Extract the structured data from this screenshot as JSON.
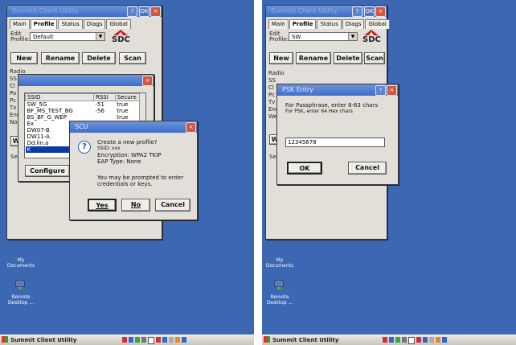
{
  "left": {
    "main_title": "Summit Client Utility",
    "tabs": [
      "Main",
      "Profile",
      "Status",
      "Diags",
      "Global"
    ],
    "edit_profile_label": "Edit\nProfile:",
    "profile_value": "Default",
    "logo": "SDC",
    "buttons": {
      "new": "New",
      "rename": "Rename",
      "delete": "Delete",
      "scan": "Scan"
    },
    "left_edge": "Radio\nSS\nCl\nPo\nPc\nTx\nEnc\nNo",
    "left_edge_w": "W",
    "left_edge_se": "Se",
    "scan_list": {
      "headers": [
        "SSID",
        "RSSI",
        "Secure"
      ],
      "rows": [
        [
          "SW_5G",
          "-51",
          "true"
        ],
        [
          "BF_MS_TEST_BG",
          "-56",
          "true"
        ],
        [
          "BS_BF_G_WEP",
          "",
          "true"
        ],
        [
          "Ex",
          "",
          ""
        ],
        [
          "DW07-B",
          "",
          ""
        ],
        [
          "DW11-A",
          "",
          ""
        ],
        [
          "Dd.lin.a",
          "",
          ""
        ],
        [
          "K",
          "",
          ""
        ]
      ],
      "configure": "Configure"
    },
    "dialog": {
      "title": "SCU",
      "lines": [
        "Create a new profile?",
        "SSID: xxx",
        "Encryption: WPA2 TKIP",
        "EAP Type: None"
      ],
      "note": "You may be prompted to enter credentials or keys.",
      "yes": "Yes",
      "no": "No",
      "cancel": "Cancel"
    },
    "desktop": {
      "my_documents": "My\nDocuments",
      "remote_desktop": "Remote\nDesktop ..."
    },
    "taskbar": {
      "start_label": "Summit Client Utility"
    }
  },
  "right": {
    "main_title": "Summit Client Utility",
    "tabs": [
      "Main",
      "Profile",
      "Status",
      "Diags",
      "Global"
    ],
    "edit_profile_label": "Edit\nProfile:",
    "profile_value": "SW",
    "logo": "SDC",
    "buttons": {
      "new": "New",
      "rename": "Rename",
      "delete": "Delete",
      "scan": "Scan"
    },
    "left_edge": "Radio\nSS\nCl\nPc\nTv\nEnc\nWe",
    "left_edge_w": "W",
    "left_edge_se": "Se",
    "psk": {
      "title": "PSK Entry",
      "line1": "For Passphrase, enter 8-63 chars",
      "line2": "For PSK, enter 64 Hex chars",
      "value": "12345678",
      "ok": "OK",
      "cancel": "Cancel"
    },
    "desktop": {
      "my_documents": "My\nDocuments",
      "remote_desktop": "Remote\nDesktop ..."
    },
    "taskbar": {
      "start_label": "Summit Client Utility"
    }
  }
}
